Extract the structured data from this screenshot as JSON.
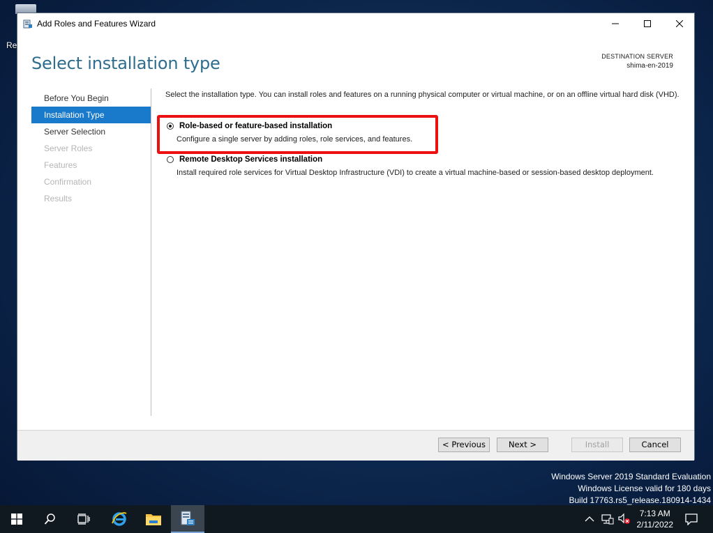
{
  "desktop": {
    "recycle_label": "Re"
  },
  "window": {
    "title": "Add Roles and Features Wizard",
    "page_title": "Select installation type",
    "destination_label": "DESTINATION SERVER",
    "destination_name": "shima-en-2019"
  },
  "nav": {
    "items": [
      {
        "label": "Before You Begin",
        "state": "normal"
      },
      {
        "label": "Installation Type",
        "state": "active"
      },
      {
        "label": "Server Selection",
        "state": "normal"
      },
      {
        "label": "Server Roles",
        "state": "disabled"
      },
      {
        "label": "Features",
        "state": "disabled"
      },
      {
        "label": "Confirmation",
        "state": "disabled"
      },
      {
        "label": "Results",
        "state": "disabled"
      }
    ]
  },
  "content": {
    "intro": "Select the installation type. You can install roles and features on a running physical computer or virtual machine, or on an offline virtual hard disk (VHD).",
    "options": [
      {
        "title": "Role-based or feature-based installation",
        "desc": "Configure a single server by adding roles, role services, and features.",
        "selected": true
      },
      {
        "title": "Remote Desktop Services installation",
        "desc": "Install required role services for Virtual Desktop Infrastructure (VDI) to create a virtual machine-based or session-based desktop deployment.",
        "selected": false
      }
    ]
  },
  "buttons": {
    "previous": "< Previous",
    "next": "Next >",
    "install": "Install",
    "cancel": "Cancel"
  },
  "watermark": {
    "line1": "Windows Server 2019 Standard Evaluation",
    "line2": "Windows License valid for 180 days",
    "line3": "Build 17763.rs5_release.180914-1434"
  },
  "taskbar": {
    "time": "7:13 AM",
    "date": "2/11/2022"
  },
  "colors": {
    "accent": "#1979ca",
    "title_blue": "#2e6d8e",
    "highlight_red": "#ec1010"
  }
}
